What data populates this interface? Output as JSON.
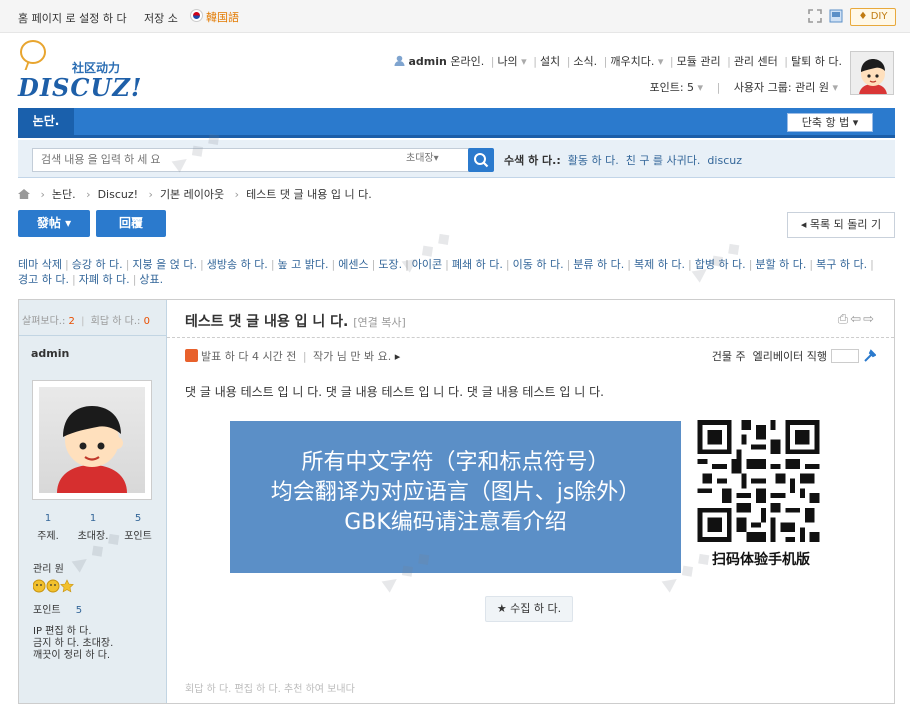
{
  "topbar": {
    "set_homepage": "홈 페이지 로 설정 하 다",
    "save": "저장 소",
    "language": "韓国語",
    "diy": "♦ DIY"
  },
  "logo": {
    "cn": "社区动力",
    "en": "DISCUZ!"
  },
  "user": {
    "name": "admin",
    "online": "온라인.",
    "links": [
      "나의",
      "설치",
      "소식.",
      "깨우치다.",
      "모듈 관리",
      "관리 센터",
      "탈퇴 하 다."
    ],
    "points": "포인트: 5",
    "group": "사용자 그룹: 관리 원"
  },
  "nav": {
    "forum_tab": "논단.",
    "shortcut": "단축 항 법 ▾"
  },
  "search": {
    "placeholder": "검색 내용 을 입력 하 세 요",
    "type": "초대장▾",
    "hot_label": "수색 하 다.:",
    "hot_items": [
      "활동 하 다.",
      "친 구 를 사귀다.",
      "discuz"
    ]
  },
  "breadcrumb": [
    "논단.",
    "Discuz!",
    "기본 레이아웃",
    "테스트 댓 글 내용 입 니 다."
  ],
  "actions": {
    "post": "發帖 ▾",
    "reply": "回覆",
    "back": "◂ 목록 되 돌리 기"
  },
  "mod_actions": [
    "테마 삭제",
    "승강 하 다.",
    "지붕 을 얹 다.",
    "생방송 하 다.",
    "높 고 밝다.",
    "에센스",
    "도장.",
    "아이콘",
    "폐쇄 하 다.",
    "이동 하 다.",
    "분류 하 다.",
    "복제 하 다.",
    "합병 하 다.",
    "분할 하 다.",
    "복구 하 다.",
    "경고 하 다.",
    "자폐 하 다.",
    "상표."
  ],
  "thread": {
    "views_label": "살펴보다.:",
    "views": "2",
    "replies_label": "회답 하 다.:",
    "replies": "0",
    "title": "테스트 댓 글 내용 입 니 다.",
    "copy_link": "[연결 복사]",
    "author": "admin",
    "posted": "발표 하 다 4 시간 전",
    "author_only": "작가 님 만 봐 요.",
    "floor_label": "건물 주",
    "elevator": "엘리베이터 직행",
    "content": "댓 글 내용 테스트 입 니 다. 댓 글 내용 테스트 입 니 다. 댓 글 내용 테스트 입 니 다.",
    "favorite": "★ 수집 하 다.",
    "ops": "회답 하 다.   편집 하 다.   추천 하여 보내다"
  },
  "profile": {
    "counts": [
      {
        "value": "1",
        "label": "주제."
      },
      {
        "value": "1",
        "label": "초대장."
      },
      {
        "value": "5",
        "label": "포인트"
      }
    ],
    "group": "관리 원",
    "points_label": "포인트",
    "points": "5",
    "lines": [
      "IP 편집 하 다.",
      "금지 하 다. 초대장.",
      "깨끗이 정리 하 다."
    ]
  },
  "banner": {
    "line1": "所有中文字符（字和标点符号）",
    "line2": "均会翻译为对应语言（图片、js除外）",
    "line3": "GBK编码请注意看介绍",
    "qr_caption": "扫码体验手机版"
  },
  "colors": {
    "brand_blue": "#2b7acd",
    "banner_blue": "#5b8fc7",
    "orange": "#e37a00"
  }
}
